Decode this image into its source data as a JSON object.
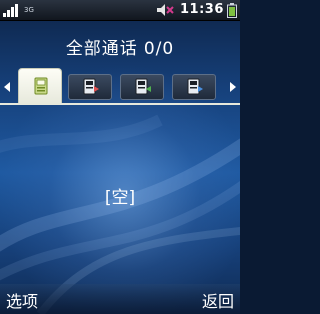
{
  "status_bar": {
    "network_label": "3G",
    "time": "11:36",
    "icons": [
      "signal-icon",
      "mute-icon",
      "battery-icon"
    ]
  },
  "header": {
    "title": "全部通话",
    "count": "0/0"
  },
  "tabs": [
    {
      "icon": "all-calls-icon",
      "selected": true
    },
    {
      "icon": "missed-calls-icon",
      "selected": false
    },
    {
      "icon": "received-calls-icon",
      "selected": false
    },
    {
      "icon": "dialed-calls-icon",
      "selected": false
    }
  ],
  "main": {
    "empty_text": "[空]"
  },
  "softkeys": {
    "left": "选项",
    "right": "返回"
  },
  "colors": {
    "background": "#1f5aa2",
    "active_tab": "#fdfdf6",
    "accent_green": "#8fb33a",
    "mute_red": "#d23a8c"
  }
}
